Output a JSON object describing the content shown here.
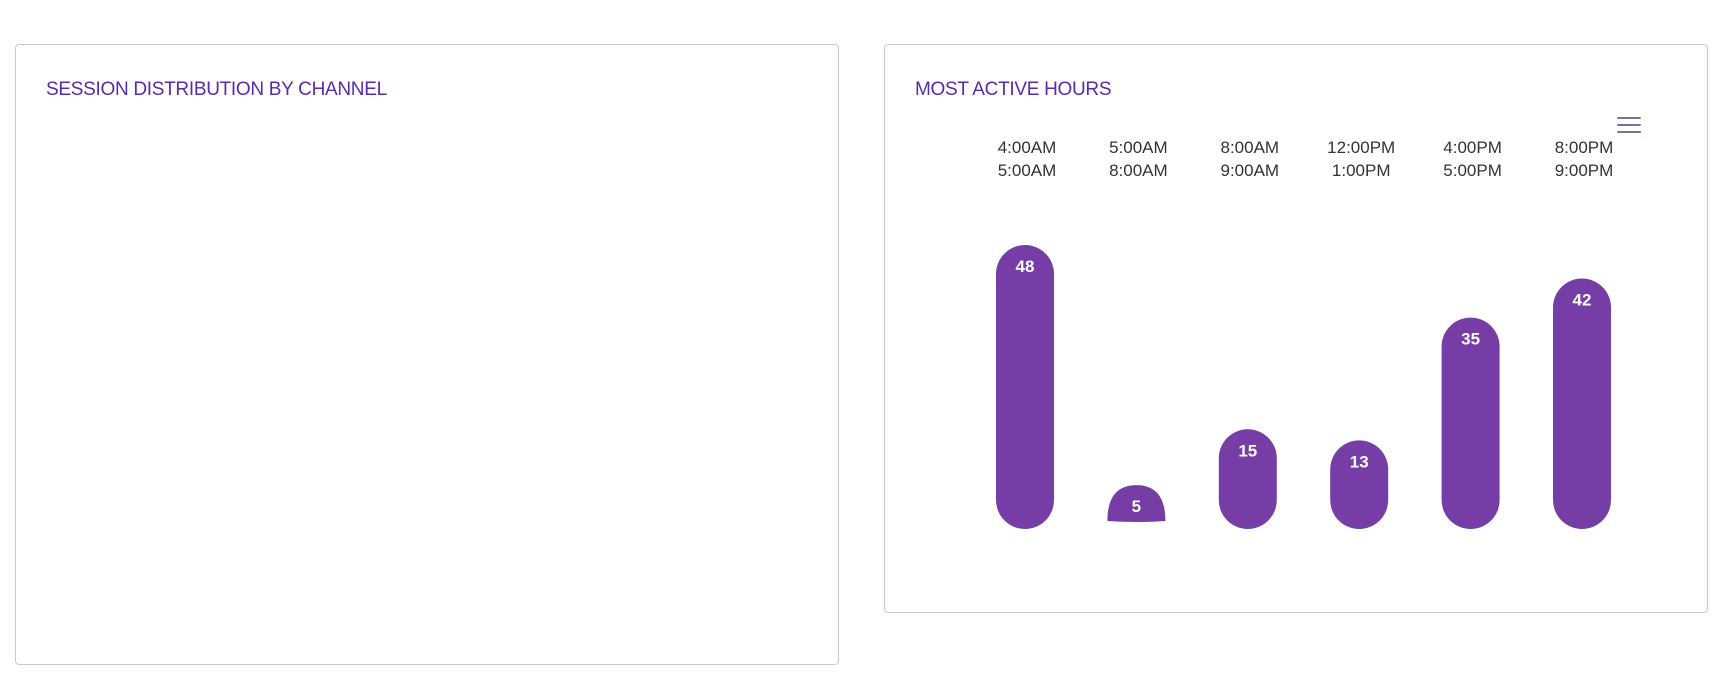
{
  "left_card": {
    "title": "SESSION DISTRIBUTION BY CHANNEL"
  },
  "right_card": {
    "title": "MOST ACTIVE HOURS",
    "menu_icon": "hamburger-menu-icon"
  },
  "colors": {
    "bar": "#773da6",
    "title": "#5b2aa8",
    "menu": "#6e7a93"
  },
  "chart_data": {
    "type": "bar",
    "title": "MOST ACTIVE HOURS",
    "categories": [
      [
        "4:00AM",
        "5:00AM"
      ],
      [
        "5:00AM",
        "8:00AM"
      ],
      [
        "8:00AM",
        "9:00AM"
      ],
      [
        "12:00PM",
        "1:00PM"
      ],
      [
        "4:00PM",
        "5:00PM"
      ],
      [
        "8:00PM",
        "9:00PM"
      ]
    ],
    "values": [
      48,
      5,
      15,
      13,
      35,
      42
    ],
    "ylim": [
      0,
      48
    ],
    "xaxis_position": "top",
    "data_labels": true,
    "grid": false,
    "legend": false
  }
}
